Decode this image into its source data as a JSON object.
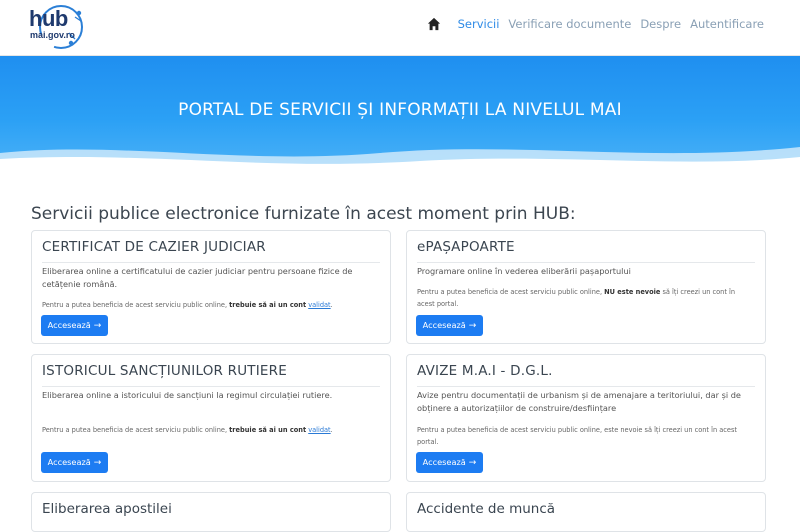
{
  "logo": {
    "hub": "hub",
    "domain": "mai.gov.ro"
  },
  "nav": {
    "items": [
      {
        "label": "Servicii",
        "active": true
      },
      {
        "label": "Verificare documente",
        "active": false
      },
      {
        "label": "Despre",
        "active": false
      },
      {
        "label": "Autentificare",
        "active": false
      }
    ]
  },
  "hero": {
    "title": "PORTAL DE SERVICII ȘI INFORMAȚII LA NIVELUL MAI"
  },
  "main": {
    "section_title": "Servicii publice electronice furnizate în acest moment prin HUB:",
    "button_label": "Accesează",
    "cards": [
      {
        "title": "CERTIFICAT DE CAZIER JUDICIAR",
        "description": "Eliberarea online a certificatului de cazier judiciar pentru persoane fizice de cetățenie română.",
        "note_pre": "Pentru a putea beneficia de acest serviciu public online, ",
        "note_bold": "trebuie să ai un cont",
        "note_link": "validat",
        "note_post": "."
      },
      {
        "title": "ePAȘAPOARTE",
        "description": "Programare online în vederea eliberării pașaportului",
        "note_pre": "Pentru a putea beneficia de acest serviciu public online, ",
        "note_bold": "NU este nevoie",
        "note_post": " să îți creezi un cont în acest portal."
      },
      {
        "title": "ISTORICUL SANCȚIUNILOR RUTIERE",
        "description": "Eliberarea online a istoricului de sancțiuni la regimul circulației rutiere.",
        "note_pre": "Pentru a putea beneficia de acest serviciu public online, ",
        "note_bold": "trebuie să ai un cont",
        "note_link": "validat",
        "note_post": "."
      },
      {
        "title": "AVIZE M.A.I - D.G.L.",
        "description": "Avize pentru documentații de urbanism și de amenajare a teritoriului, dar și de obținere a autorizațiilor de construire/desființare",
        "note_pre": "Pentru a putea beneficia de acest serviciu public online, este nevoie să îți creezi un cont în acest portal."
      },
      {
        "title": "Eliberarea apostilei"
      },
      {
        "title": "Accidente de muncă"
      }
    ]
  },
  "colors": {
    "accent": "#1d7cf2",
    "hero": "#2ba0f5",
    "nav_active": "#2f8be6"
  }
}
